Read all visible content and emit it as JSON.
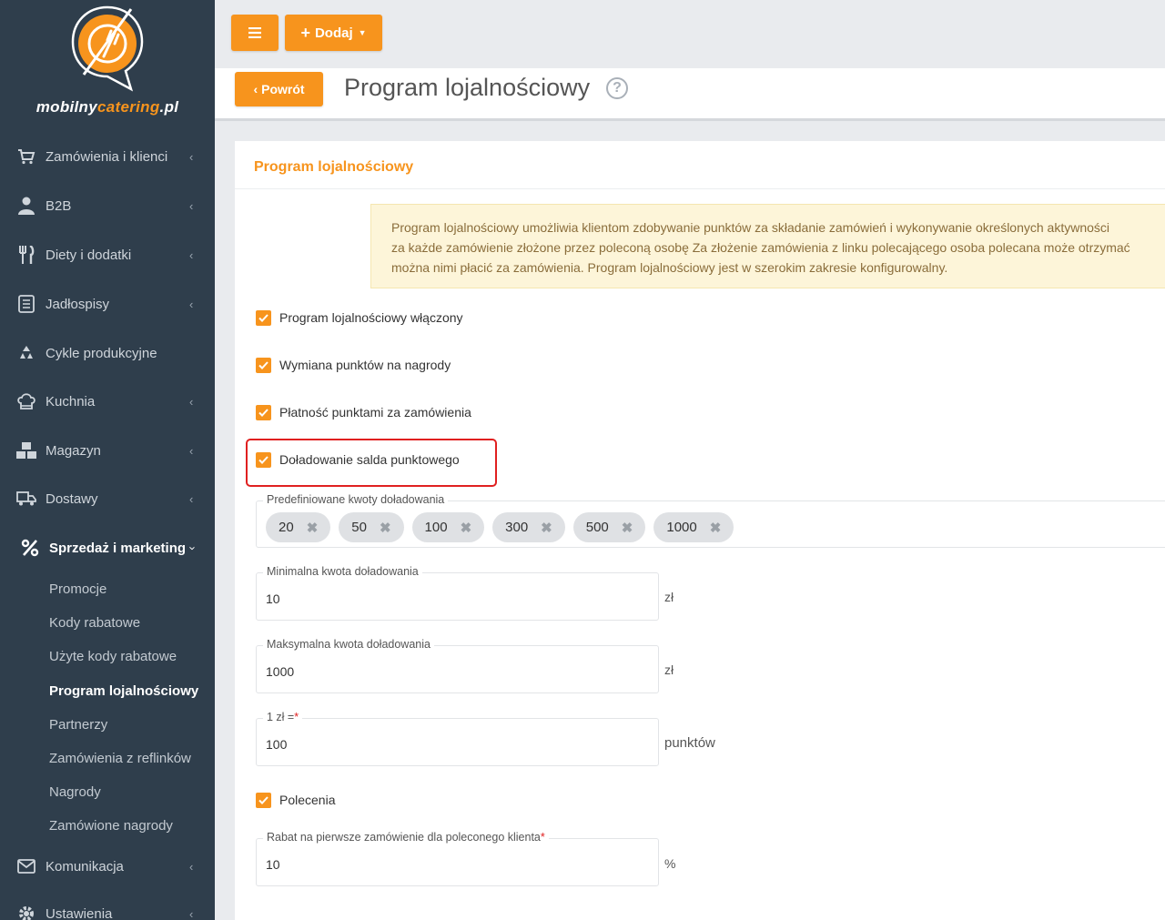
{
  "brand": {
    "name_main": "mobilny",
    "name_accent": "catering",
    "name_suffix": ".pl"
  },
  "sidebar": {
    "items": [
      {
        "label": "Zamówienia i klienci",
        "icon": "cart-icon"
      },
      {
        "label": "B2B",
        "icon": "user-icon"
      },
      {
        "label": "Diety i dodatki",
        "icon": "utensils-icon"
      },
      {
        "label": "Jadłospisy",
        "icon": "menu-list-icon"
      },
      {
        "label": "Cykle produkcyjne",
        "icon": "recycle-icon"
      },
      {
        "label": "Kuchnia",
        "icon": "chef-hat-icon"
      },
      {
        "label": "Magazyn",
        "icon": "boxes-icon"
      },
      {
        "label": "Dostawy",
        "icon": "truck-icon"
      },
      {
        "label": "Sprzedaż i marketing",
        "icon": "percent-icon"
      },
      {
        "label": "Komunikacja",
        "icon": "envelope-icon"
      },
      {
        "label": "Ustawienia",
        "icon": "gear-icon"
      }
    ],
    "sub_items": [
      "Promocje",
      "Kody rabatowe",
      "Użyte kody rabatowe",
      "Program lojalnościowy",
      "Partnerzy",
      "Zamówienia z reflinków",
      "Nagrody",
      "Zamówione nagrody"
    ]
  },
  "toolbar": {
    "add_label": "Dodaj",
    "back_label": "Powrót"
  },
  "header": {
    "title": "Program lojalnościowy",
    "help": "?"
  },
  "card": {
    "title": "Program lojalnościowy",
    "info_line1": "Program lojalnościowy umożliwia klientom zdobywanie punktów za składanie zamówień i wykonywanie określonych aktywności",
    "info_line2": "za każde zamówienie złożone przez poleconą osobę Za złożenie zamówienia z linku polecającego osoba polecana może otrzymać",
    "info_line3": "można nimi płacić za zamówienia. Program lojalnościowy jest w szerokim zakresie konfigurowalny."
  },
  "checks": {
    "enabled": "Program lojalnościowy włączony",
    "exchange": "Wymiana punktów na nagrody",
    "payment": "Płatność punktami za zamówienia",
    "topup": "Doładowanie salda punktowego",
    "referrals": "Polecenia"
  },
  "fields": {
    "predefined_label": "Predefiniowane kwoty doładowania",
    "predefined_values": [
      "20",
      "50",
      "100",
      "300",
      "500",
      "1000"
    ],
    "min_label": "Minimalna kwota doładowania",
    "min_value": "10",
    "min_unit": "zł",
    "max_label": "Maksymalna kwota doładowania",
    "max_value": "1000",
    "max_unit": "zł",
    "rate_label": "1 zł =",
    "rate_required": "*",
    "rate_value": "100",
    "rate_unit": "punktów",
    "discount_label": "Rabat na pierwsze zamówienie dla poleconego klienta",
    "discount_required": "*",
    "discount_value": "10",
    "discount_unit": "%"
  },
  "colors": {
    "accent": "#f7941d",
    "sidebar_bg": "#2f3e4c",
    "highlight": "#e02020",
    "info_bg": "#fdf5d9"
  }
}
